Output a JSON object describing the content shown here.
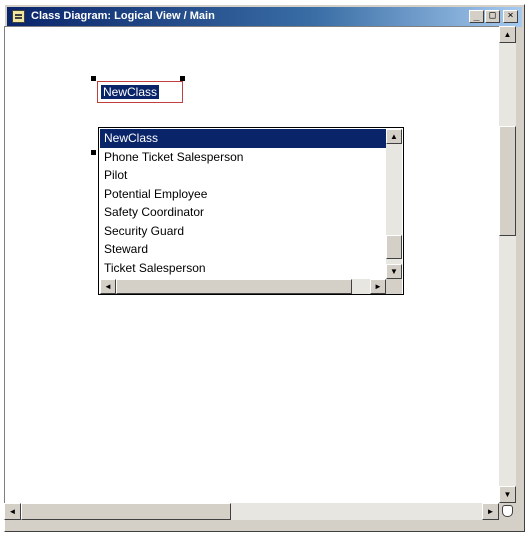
{
  "window": {
    "title": "Class Diagram: Logical View / Main",
    "minimize": "_",
    "maximize": "□",
    "close": "×"
  },
  "icons": {
    "diagram": "diagram-icon",
    "up": "▲",
    "down": "▼",
    "left": "◄",
    "right": "►"
  },
  "class_node": {
    "name_value": "NewClass"
  },
  "dropdown": {
    "items": [
      "NewClass",
      "Phone Ticket Salesperson",
      "Pilot",
      "Potential Employee",
      "Safety Coordinator",
      "Security Guard",
      "Steward",
      "Ticket Salesperson"
    ],
    "selected_index": 0
  },
  "colors": {
    "selection": "#0a246a",
    "edit_border": "#c04040",
    "chrome": "#d4d0c8"
  }
}
